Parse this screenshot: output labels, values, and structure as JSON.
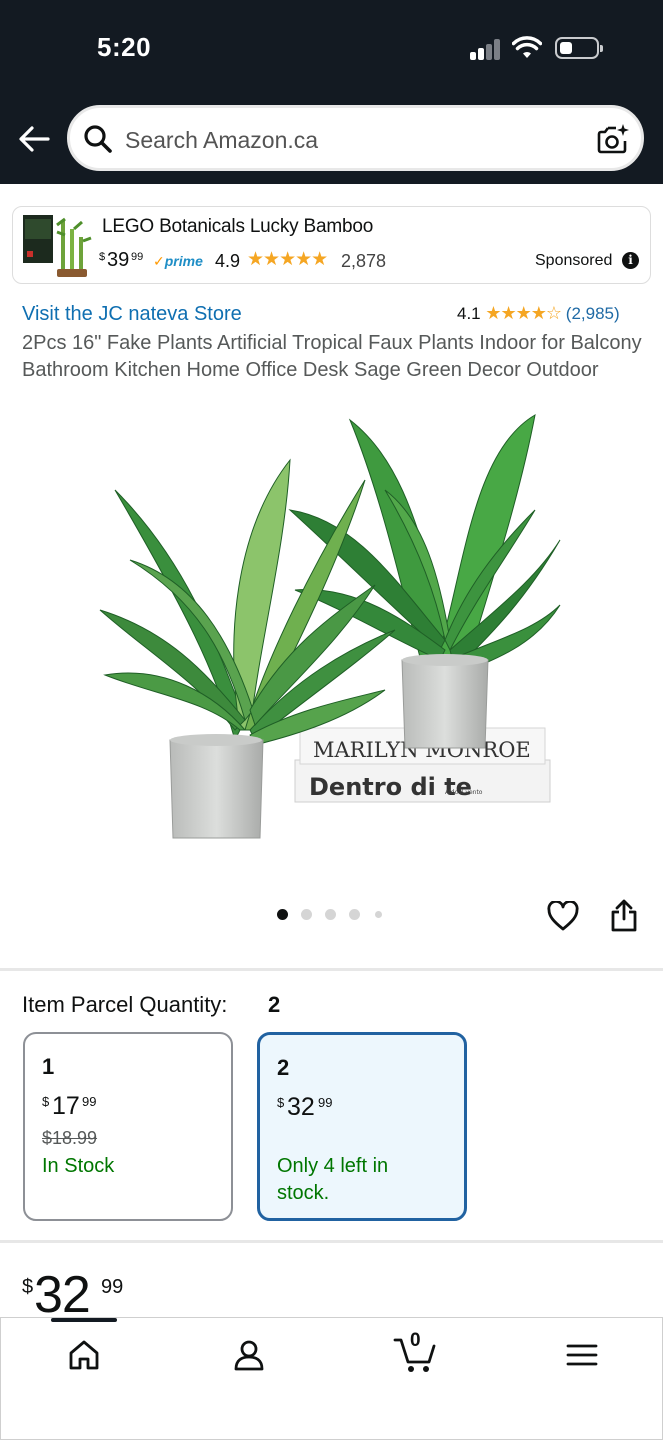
{
  "status_bar": {
    "time": "5:20"
  },
  "header": {
    "search_placeholder": "Search Amazon.ca"
  },
  "sponsored": {
    "title": "LEGO Botanicals Lucky Bamboo",
    "currency": "$",
    "price_whole": "39",
    "price_cents": "99",
    "prime_label": "prime",
    "rating": "4.9",
    "stars": "★★★★★",
    "review_count": "2,878",
    "sponsored_label": "Sponsored",
    "info_icon_text": "i"
  },
  "product": {
    "store_link": "Visit the JC nateva Store",
    "rating": "4.1",
    "stars": "★★★★☆",
    "review_count": "(2,985)",
    "title": "2Pcs 16\" Fake Plants Artificial Tropical Faux Plants Indoor for Balcony Bathroom Kitchen Home Office Desk Sage Green Decor Outdoor",
    "image_text": {
      "book_top": "MARILYN MONROE",
      "book_bottom": "Dentro di te",
      "book_bottom_small": "Aldo il vento"
    },
    "image_count": 5,
    "image_index": 1
  },
  "quantity": {
    "label": "Item Parcel Quantity:",
    "selected_value": "2",
    "options": [
      {
        "qty": "1",
        "currency": "$",
        "whole": "17",
        "cents": "99",
        "was_price": "$18.99",
        "stock": "In Stock"
      },
      {
        "qty": "2",
        "currency": "$",
        "whole": "32",
        "cents": "99",
        "stock_line1": "Only 4 left in",
        "stock_line2": "stock."
      }
    ]
  },
  "big_price": {
    "currency": "$",
    "whole": "32",
    "cents": "99"
  },
  "bottom_nav": {
    "cart_count": "0"
  }
}
